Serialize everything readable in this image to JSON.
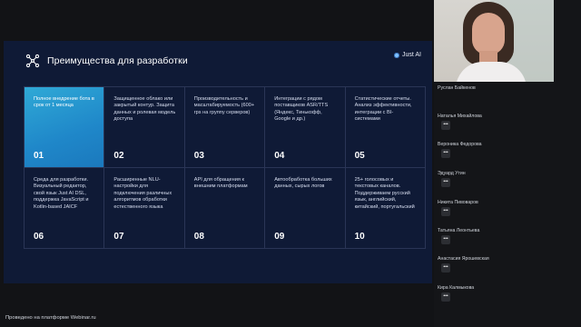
{
  "slide": {
    "title": "Преимущества для разработки",
    "brand": "Just AI",
    "cells": [
      {
        "text": "Полное внедрение бота в срок от 1 месяца",
        "num": "01"
      },
      {
        "text": "Защищенное облако или закрытый контур. Защита данных и ролевая модель доступа",
        "num": "02"
      },
      {
        "text": "Производительность и масштабируемость (600+ rps на группу серверов)",
        "num": "03"
      },
      {
        "text": "Интеграции с рядом поставщиков ASR/TTS (Яндекс, Тинькофф, Google и др.)",
        "num": "04"
      },
      {
        "text": "Статистические отчеты. Анализ эффективности, интеграции с BI-системами",
        "num": "05"
      },
      {
        "text": "Среда для разработки. Визуальный редактор, свой язык Just AI DSL, поддержка JavaScript и Kotlin-based JAICF",
        "num": "06"
      },
      {
        "text": "Расширенные NLU-настройки для подключения различных алгоритмов обработки естественного языка",
        "num": "07"
      },
      {
        "text": "API для обращения к внешним платформам",
        "num": "08"
      },
      {
        "text": "Автообработка больших данных, сырых логов",
        "num": "09"
      },
      {
        "text": "25+ голосовых и текстовых каналов. Поддерживаем русский язык, английский, китайский, португальский",
        "num": "10"
      }
    ]
  },
  "footer": {
    "text": "Проведено на платформе Webinar.ru"
  },
  "participants": [
    {
      "name": "Руслан Байкенов"
    },
    {
      "name": "Наталья Михайлова"
    },
    {
      "name": "Вероника Федорова"
    },
    {
      "name": "Эдуард Утин"
    },
    {
      "name": "Никита Пивоваров"
    },
    {
      "name": "Татьяна Леонтьева"
    },
    {
      "name": "Анастасия Ярошевская"
    },
    {
      "name": "Кира Калмыкова"
    }
  ],
  "colors": {
    "slide_bg": "#0f1a36",
    "highlight": "#2fa9d6",
    "grid_line": "#2a3556"
  },
  "icons": {
    "logo": "network-nodes-icon",
    "more": "more-icon"
  }
}
